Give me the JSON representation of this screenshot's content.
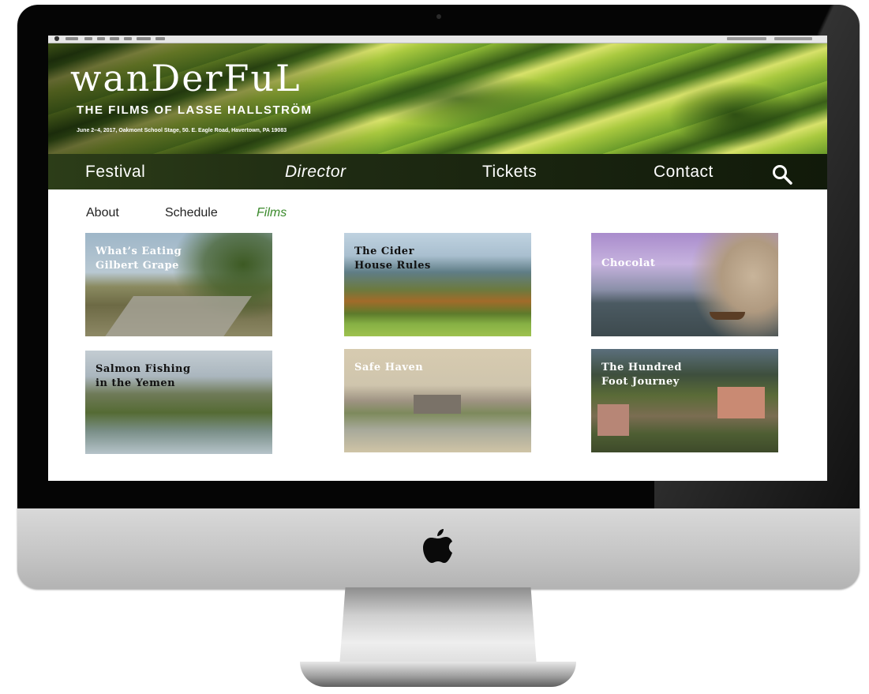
{
  "site": {
    "brand": "wanDerFuL",
    "subtitle": "THE FILMS OF LASSE HALLSTRÖM",
    "event_info": "June 2–4, 2017,  Oakmont School Stage,  50. E. Eagle Road, Havertown, PA 19083"
  },
  "main_nav": [
    {
      "label": "Festival",
      "active": false
    },
    {
      "label": "Director",
      "active": true
    },
    {
      "label": "Tickets",
      "active": false
    },
    {
      "label": "Contact",
      "active": false
    }
  ],
  "sub_nav": [
    {
      "label": "About",
      "active": false
    },
    {
      "label": "Schedule",
      "active": false
    },
    {
      "label": "Films",
      "active": true
    }
  ],
  "films": [
    {
      "title": "What’s Eating\nGilbert Grape",
      "title_color": "#ffffff"
    },
    {
      "title": "The Cider\nHouse Rules",
      "title_color": "#111111"
    },
    {
      "title": "Chocolat",
      "title_color": "#ffffff"
    },
    {
      "title": "Salmon Fishing\nin the Yemen",
      "title_color": "#111111"
    },
    {
      "title": "Safe Haven",
      "title_color": "#ffffff"
    },
    {
      "title": "The Hundred\nFoot Journey",
      "title_color": "#ffffff"
    }
  ],
  "colors": {
    "accent_active_subnav": "#3b8a2c",
    "nav_background": "#1e2a12"
  },
  "icons": {
    "search": "search-icon",
    "device_logo": "apple-logo-icon"
  }
}
